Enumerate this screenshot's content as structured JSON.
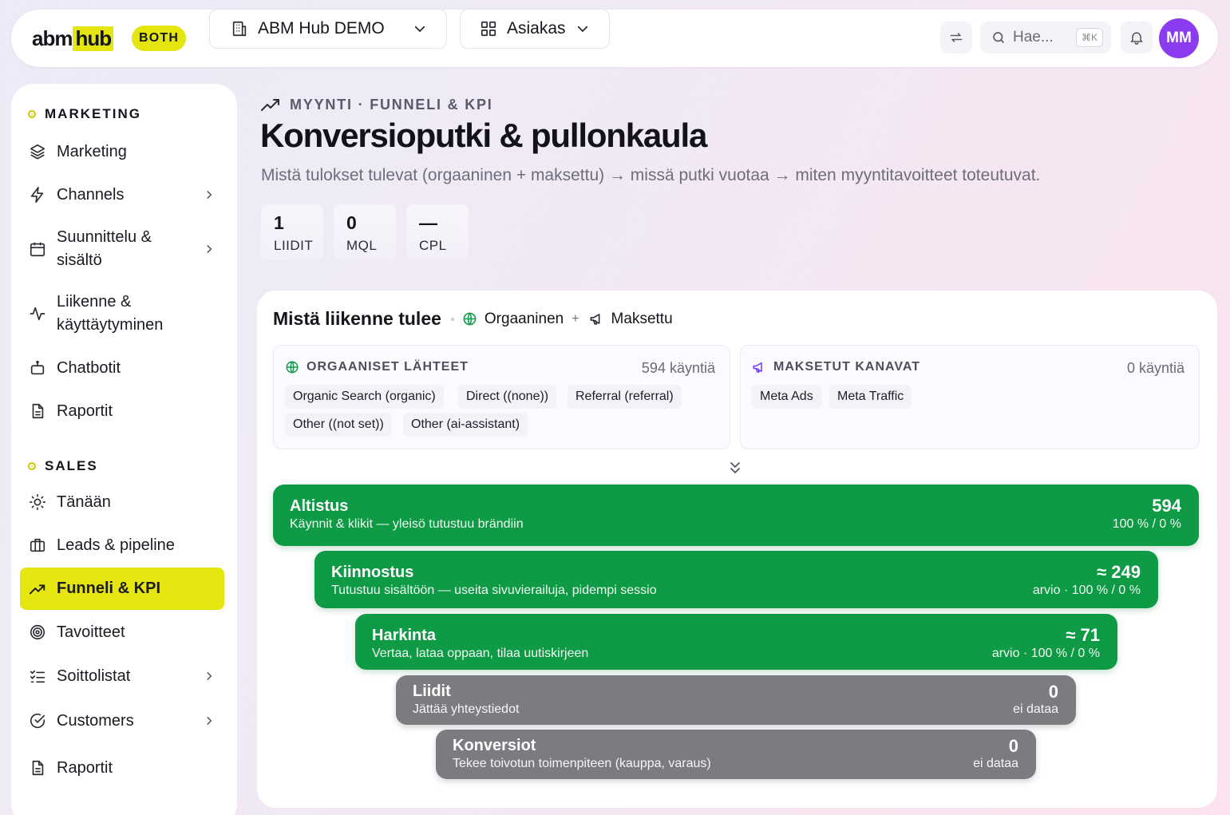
{
  "topbar": {
    "logo_left": "abm",
    "logo_right": "hub",
    "badge": "BOTH",
    "workspace": "ABM Hub DEMO",
    "view": "Asiakas",
    "search_placeholder": "Hae...",
    "search_shortcut": "⌘K",
    "avatar_initials": "MM"
  },
  "sidebar": {
    "marketing_header": "MARKETING",
    "marketing_items": [
      {
        "label": "Marketing",
        "icon": "layers-icon"
      },
      {
        "label": "Channels",
        "icon": "bolt-icon",
        "has_children": true
      },
      {
        "label": "Suunnittelu & sisältö",
        "icon": "calendar-icon",
        "has_children": true
      },
      {
        "label": "Liikenne & käyttäytyminen",
        "icon": "activity-icon"
      },
      {
        "label": "Chatbotit",
        "icon": "bot-icon"
      },
      {
        "label": "Raportit",
        "icon": "report-icon"
      }
    ],
    "sales_header": "SALES",
    "sales_items": [
      {
        "label": "Tänään",
        "icon": "sun-icon"
      },
      {
        "label": "Leads & pipeline",
        "icon": "briefcase-icon"
      },
      {
        "label": "Funneli & KPI",
        "icon": "trending-up-icon",
        "active": true
      },
      {
        "label": "Tavoitteet",
        "icon": "target-icon"
      },
      {
        "label": "Soittolistat",
        "icon": "checklist-icon",
        "has_children": true
      },
      {
        "label": "Customers",
        "icon": "check-circle-icon",
        "has_children": true
      },
      {
        "label": "Raportit",
        "icon": "report-icon"
      }
    ]
  },
  "main": {
    "kicker": "MYYNTI · FUNNELI & KPI",
    "title": "Konversioputki & pullonkaula",
    "subtitle": "Mistä tulokset tulevat (orgaaninen + maksettu) → missä putki vuotaa → miten myyntitavoitteet toteutuvat.",
    "kpis": [
      {
        "value": "1",
        "label": "LIIDIT"
      },
      {
        "value": "0",
        "label": "MQL"
      },
      {
        "value": "—",
        "label": "CPL"
      }
    ]
  },
  "traffic": {
    "title": "Mistä liikenne tulee",
    "organic_tag": "Orgaaninen",
    "plus": "+",
    "paid_tag": "Maksettu",
    "organic": {
      "header": "ORGAANISET LÄHTEET",
      "count": "594 käyntiä",
      "chips": [
        "Organic Search (organic)",
        "Direct ((none))",
        "Referral (referral)",
        "Other ((not set))",
        "Other (ai-assistant)"
      ]
    },
    "paid": {
      "header": "MAKSETUT KANAVAT",
      "count": "0 käyntiä",
      "chips": [
        "Meta Ads",
        "Meta Traffic"
      ]
    }
  },
  "funnel": {
    "stages": [
      {
        "name": "Altistus",
        "desc": "Käynnit & klikit — yleisö tutustuu brändiin",
        "value": "594",
        "meta": "100 % / 0 %",
        "status": "data"
      },
      {
        "name": "Kiinnostus",
        "desc": "Tutustuu sisältöön — useita sivuvierailuja, pidempi sessio",
        "value": "≈ 249",
        "meta": "arvio · 100 % / 0 %",
        "status": "data"
      },
      {
        "name": "Harkinta",
        "desc": "Vertaa, lataa oppaan, tilaa uutiskirjeen",
        "value": "≈ 71",
        "meta": "arvio · 100 % / 0 %",
        "status": "data"
      },
      {
        "name": "Liidit",
        "desc": "Jättää yhteystiedot",
        "value": "0",
        "meta": "ei dataa",
        "status": "nodata"
      },
      {
        "name": "Konversiot",
        "desc": "Tekee toivotun toimenpiteen (kauppa, varaus)",
        "value": "0",
        "meta": "ei dataa",
        "status": "nodata"
      }
    ]
  },
  "colors": {
    "accent": "#e5e50f",
    "funnel_green": "#0f9a45",
    "funnel_gray": "#7c7b80",
    "avatar": "#8b3cf0"
  }
}
